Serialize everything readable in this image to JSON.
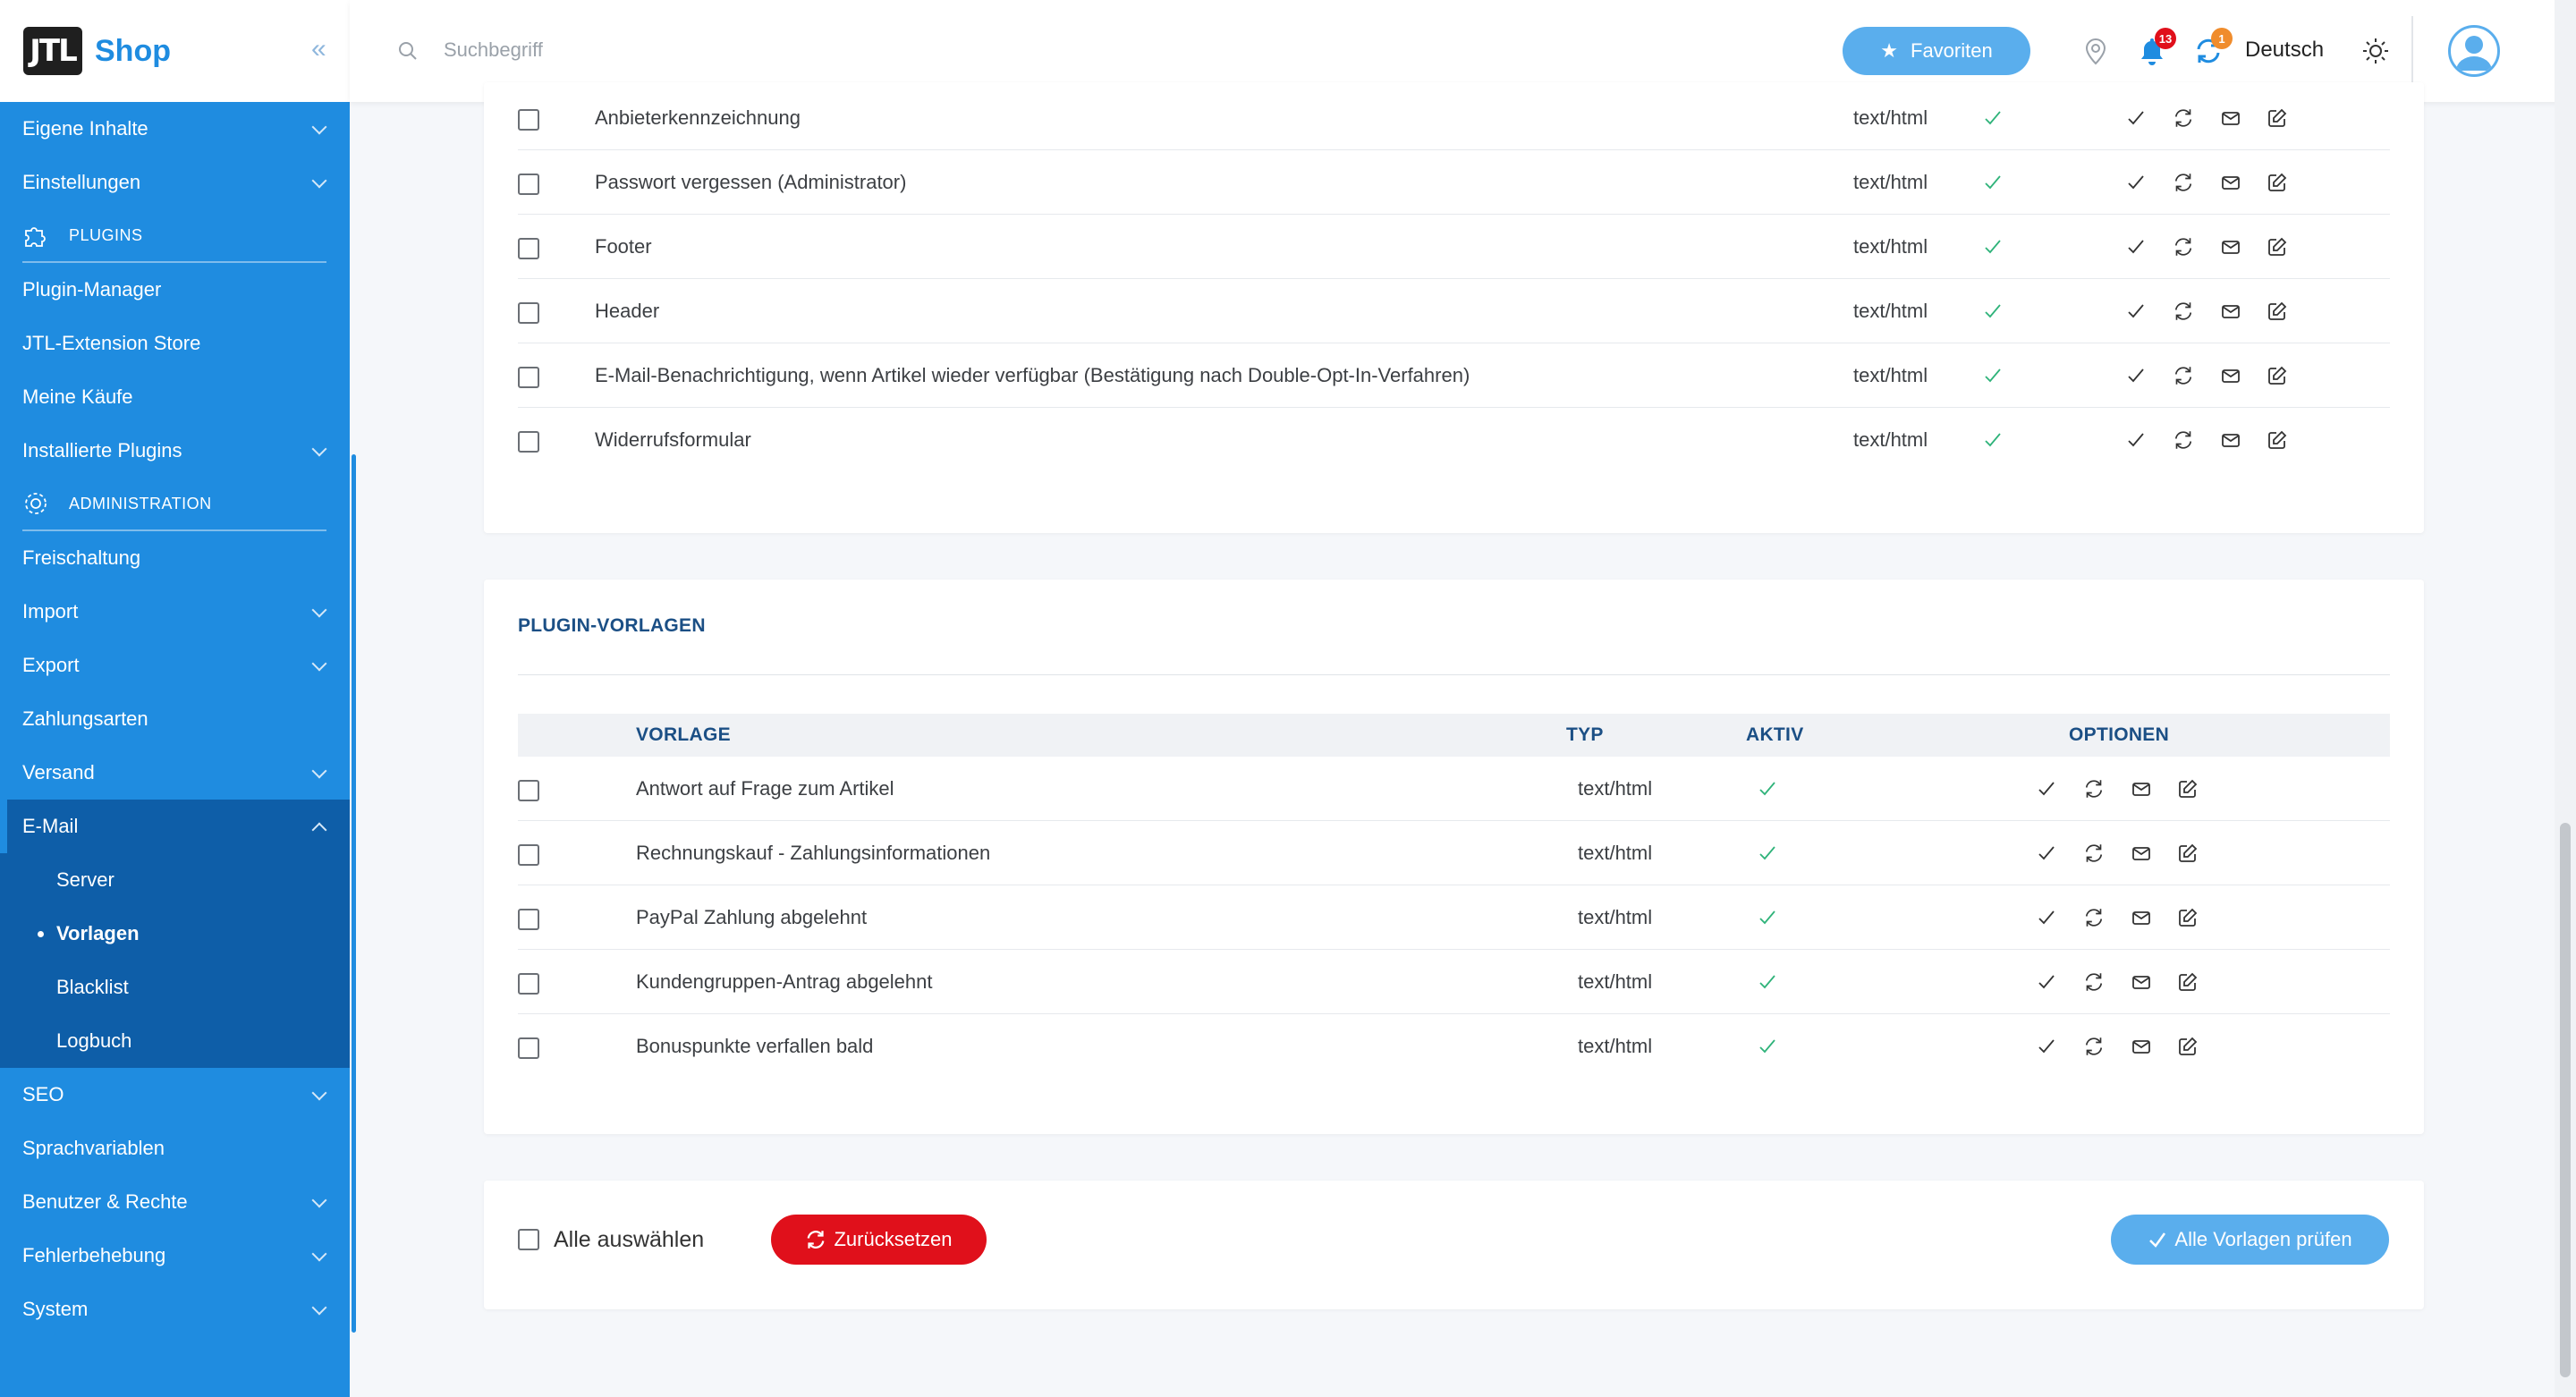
{
  "brand": {
    "logo": "JTL",
    "name": "Shop"
  },
  "sidebar": {
    "items_top": [
      {
        "label": "Eigene Inhalte",
        "expandable": true
      },
      {
        "label": "Einstellungen",
        "expandable": true
      }
    ],
    "section_plugins": "PLUGINS",
    "plugins": [
      {
        "label": "Plugin-Manager",
        "expandable": false
      },
      {
        "label": "JTL-Extension Store",
        "expandable": false
      },
      {
        "label": "Meine Käufe",
        "expandable": false
      },
      {
        "label": "Installierte Plugins",
        "expandable": true
      }
    ],
    "section_admin": "ADMINISTRATION",
    "admin": [
      {
        "label": "Freischaltung",
        "expandable": false
      },
      {
        "label": "Import",
        "expandable": true
      },
      {
        "label": "Export",
        "expandable": true
      },
      {
        "label": "Zahlungsarten",
        "expandable": false
      },
      {
        "label": "Versand",
        "expandable": true
      }
    ],
    "email": {
      "label": "E-Mail",
      "sub": [
        "Server",
        "Vorlagen",
        "Blacklist",
        "Logbuch"
      ],
      "current": "Vorlagen"
    },
    "after": [
      {
        "label": "SEO",
        "expandable": true
      },
      {
        "label": "Sprachvariablen",
        "expandable": false
      },
      {
        "label": "Benutzer & Rechte",
        "expandable": true
      },
      {
        "label": "Fehlerbehebung",
        "expandable": true
      },
      {
        "label": "System",
        "expandable": true
      }
    ]
  },
  "topbar": {
    "search_placeholder": "Suchbegriff",
    "favorites_label": "Favoriten",
    "notifications_count": "13",
    "updates_count": "1",
    "language": "Deutsch",
    "colors": {
      "accent": "#5aaeed",
      "notif_badge": "#e0101b",
      "update_badge": "#f08c2c"
    }
  },
  "upper_table": {
    "rows": [
      {
        "name": "Anbieterkennzeichnung",
        "type": "text/html",
        "active": true
      },
      {
        "name": "Passwort vergessen (Administrator)",
        "type": "text/html",
        "active": true
      },
      {
        "name": "Footer",
        "type": "text/html",
        "active": true
      },
      {
        "name": "Header",
        "type": "text/html",
        "active": true
      },
      {
        "name": "E-Mail-Benachrichtigung, wenn Artikel wieder verfügbar (Bestätigung nach Double-Opt-In-Verfahren)",
        "type": "text/html",
        "active": true
      },
      {
        "name": "Widerrufsformular",
        "type": "text/html",
        "active": true
      }
    ]
  },
  "plugin_templates": {
    "title": "PLUGIN-VORLAGEN",
    "headers": {
      "template": "VORLAGE",
      "type": "TYP",
      "active": "AKTIV",
      "options": "OPTIONEN"
    },
    "rows": [
      {
        "name": "Antwort auf Frage zum Artikel",
        "type": "text/html",
        "active": true
      },
      {
        "name": "Rechnungskauf - Zahlungsinformationen",
        "type": "text/html",
        "active": true
      },
      {
        "name": "PayPal Zahlung abgelehnt",
        "type": "text/html",
        "active": true
      },
      {
        "name": "Kundengruppen-Antrag abgelehnt",
        "type": "text/html",
        "active": true
      },
      {
        "name": "Bonuspunkte verfallen bald",
        "type": "text/html",
        "active": true
      }
    ]
  },
  "footer": {
    "select_all_label": "Alle auswählen",
    "reset_label": "Zurücksetzen",
    "check_all_label": "Alle Vorlagen prüfen"
  }
}
